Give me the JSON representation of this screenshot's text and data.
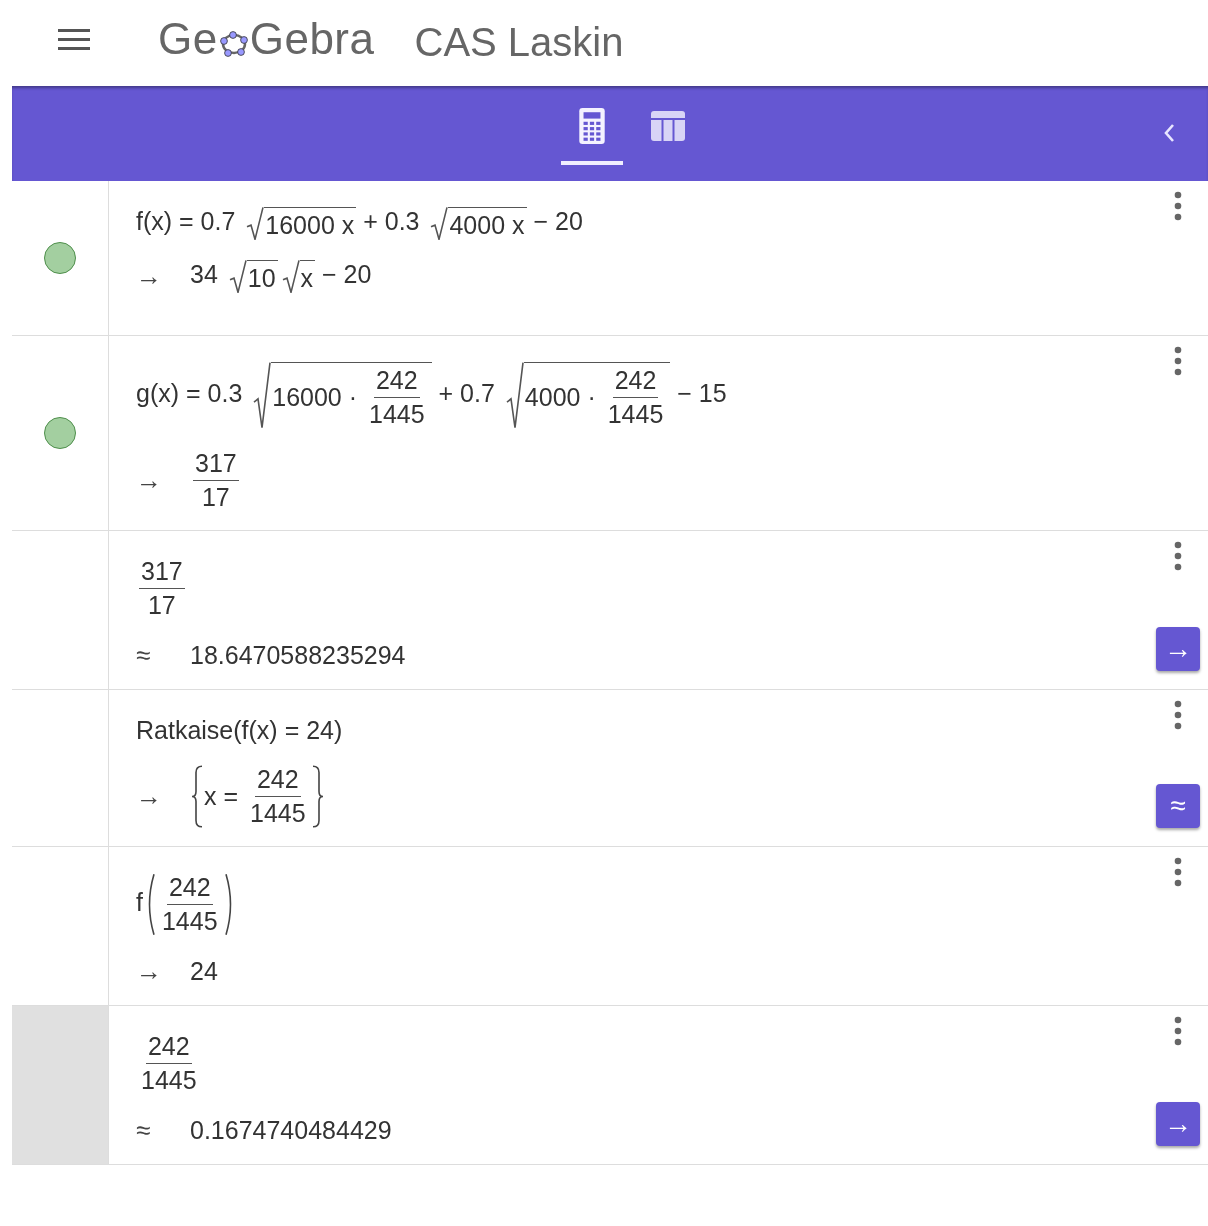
{
  "header": {
    "logo_parts": [
      "Ge",
      "Gebra"
    ],
    "app_title": "CAS Laskin"
  },
  "toolbar": {
    "tabs": [
      {
        "kind": "calculator",
        "selected": true
      },
      {
        "kind": "table",
        "selected": false
      }
    ]
  },
  "rows": [
    {
      "selected": false,
      "dot_visible": true,
      "input": [
        "f(x) = 0.7 ",
        {
          "kind": "sqrt",
          "body": [
            "16000 x"
          ]
        },
        " + 0.3 ",
        {
          "kind": "sqrt",
          "body": [
            "4000 x"
          ]
        },
        " − 20"
      ],
      "output_symbol": "→",
      "output": [
        "34 ",
        {
          "kind": "sqrt",
          "body": [
            "10"
          ]
        },
        {
          "kind": "sqrt",
          "body": [
            "x"
          ]
        },
        " − 20"
      ]
    },
    {
      "selected": false,
      "dot_visible": true,
      "input": [
        "g(x) = 0.3 ",
        {
          "kind": "sqrt",
          "body": [
            "16000 · ",
            {
              "kind": "frac",
              "num": [
                "242"
              ],
              "den": [
                "1445"
              ]
            }
          ]
        },
        " + 0.7 ",
        {
          "kind": "sqrt",
          "body": [
            "4000 · ",
            {
              "kind": "frac",
              "num": [
                "242"
              ],
              "den": [
                "1445"
              ]
            }
          ]
        },
        " − 15"
      ],
      "output_symbol": "→",
      "output": [
        {
          "kind": "frac",
          "num": [
            "317"
          ],
          "den": [
            "17"
          ]
        }
      ]
    },
    {
      "selected": false,
      "dot_visible": false,
      "input": [
        {
          "kind": "frac",
          "num": [
            "317"
          ],
          "den": [
            "17"
          ]
        }
      ],
      "output_symbol": "≈",
      "output": [
        "18.6470588235294"
      ],
      "action": "→"
    },
    {
      "selected": false,
      "dot_visible": false,
      "input": [
        "Ratkaise(f(x) = 24)"
      ],
      "output_symbol": "→",
      "output": [
        {
          "kind": "set",
          "body": [
            "x = ",
            {
              "kind": "frac",
              "num": [
                "242"
              ],
              "den": [
                "1445"
              ]
            }
          ]
        }
      ],
      "action": "≈"
    },
    {
      "selected": false,
      "dot_visible": false,
      "input": [
        "f",
        {
          "kind": "paren",
          "body": [
            {
              "kind": "frac",
              "num": [
                "242"
              ],
              "den": [
                "1445"
              ]
            }
          ]
        }
      ],
      "output_symbol": "→",
      "output": [
        "24"
      ]
    },
    {
      "selected": true,
      "dot_visible": false,
      "input": [
        {
          "kind": "frac",
          "num": [
            "242"
          ],
          "den": [
            "1445"
          ]
        }
      ],
      "output_symbol": "≈",
      "output": [
        "0.1674740484429"
      ],
      "action": "→"
    }
  ]
}
